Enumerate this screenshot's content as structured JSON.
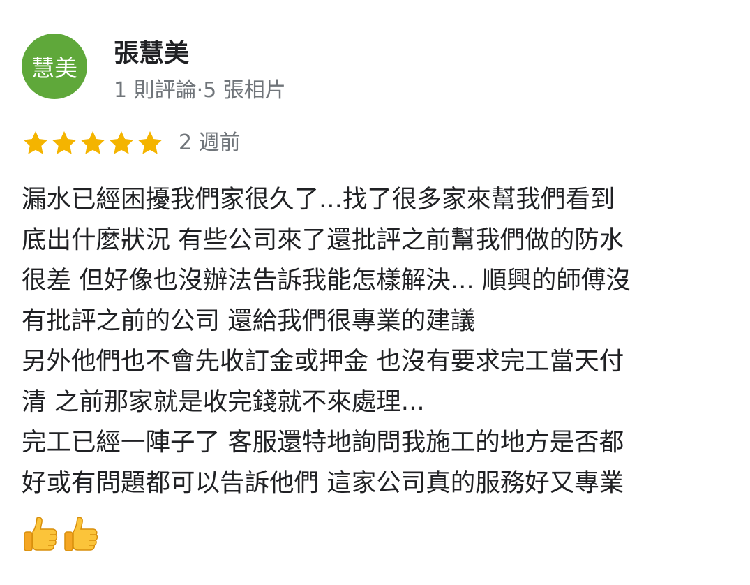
{
  "reviewer": {
    "avatar_text": "慧美",
    "avatar_color": "#5fa83a",
    "name": "張慧美",
    "meta": "1 則評論·5 張相片"
  },
  "rating": {
    "stars": 5,
    "star_color": "#f4b400",
    "time": "2 週前"
  },
  "review": {
    "lines": [
      "漏水已經困擾我們家很久了...找了很多家來幫我們看到",
      "底出什麼狀況 有些公司來了還批評之前幫我們做的防水",
      "很差 但好像也沒辦法告訴我能怎樣解決... 順興的師傅沒",
      "有批評之前的公司 還給我們很專業的建議",
      "另外他們也不會先收訂金或押金 也沒有要求完工當天付",
      "清 之前那家就是收完錢就不來處理...",
      "完工已經一陣子了 客服還特地詢問我施工的地方是否都",
      "好或有問題都可以告訴他們 這家公司真的服務好又專業"
    ],
    "emojis": [
      "thumbs-up-icon",
      "thumbs-up-icon"
    ]
  }
}
